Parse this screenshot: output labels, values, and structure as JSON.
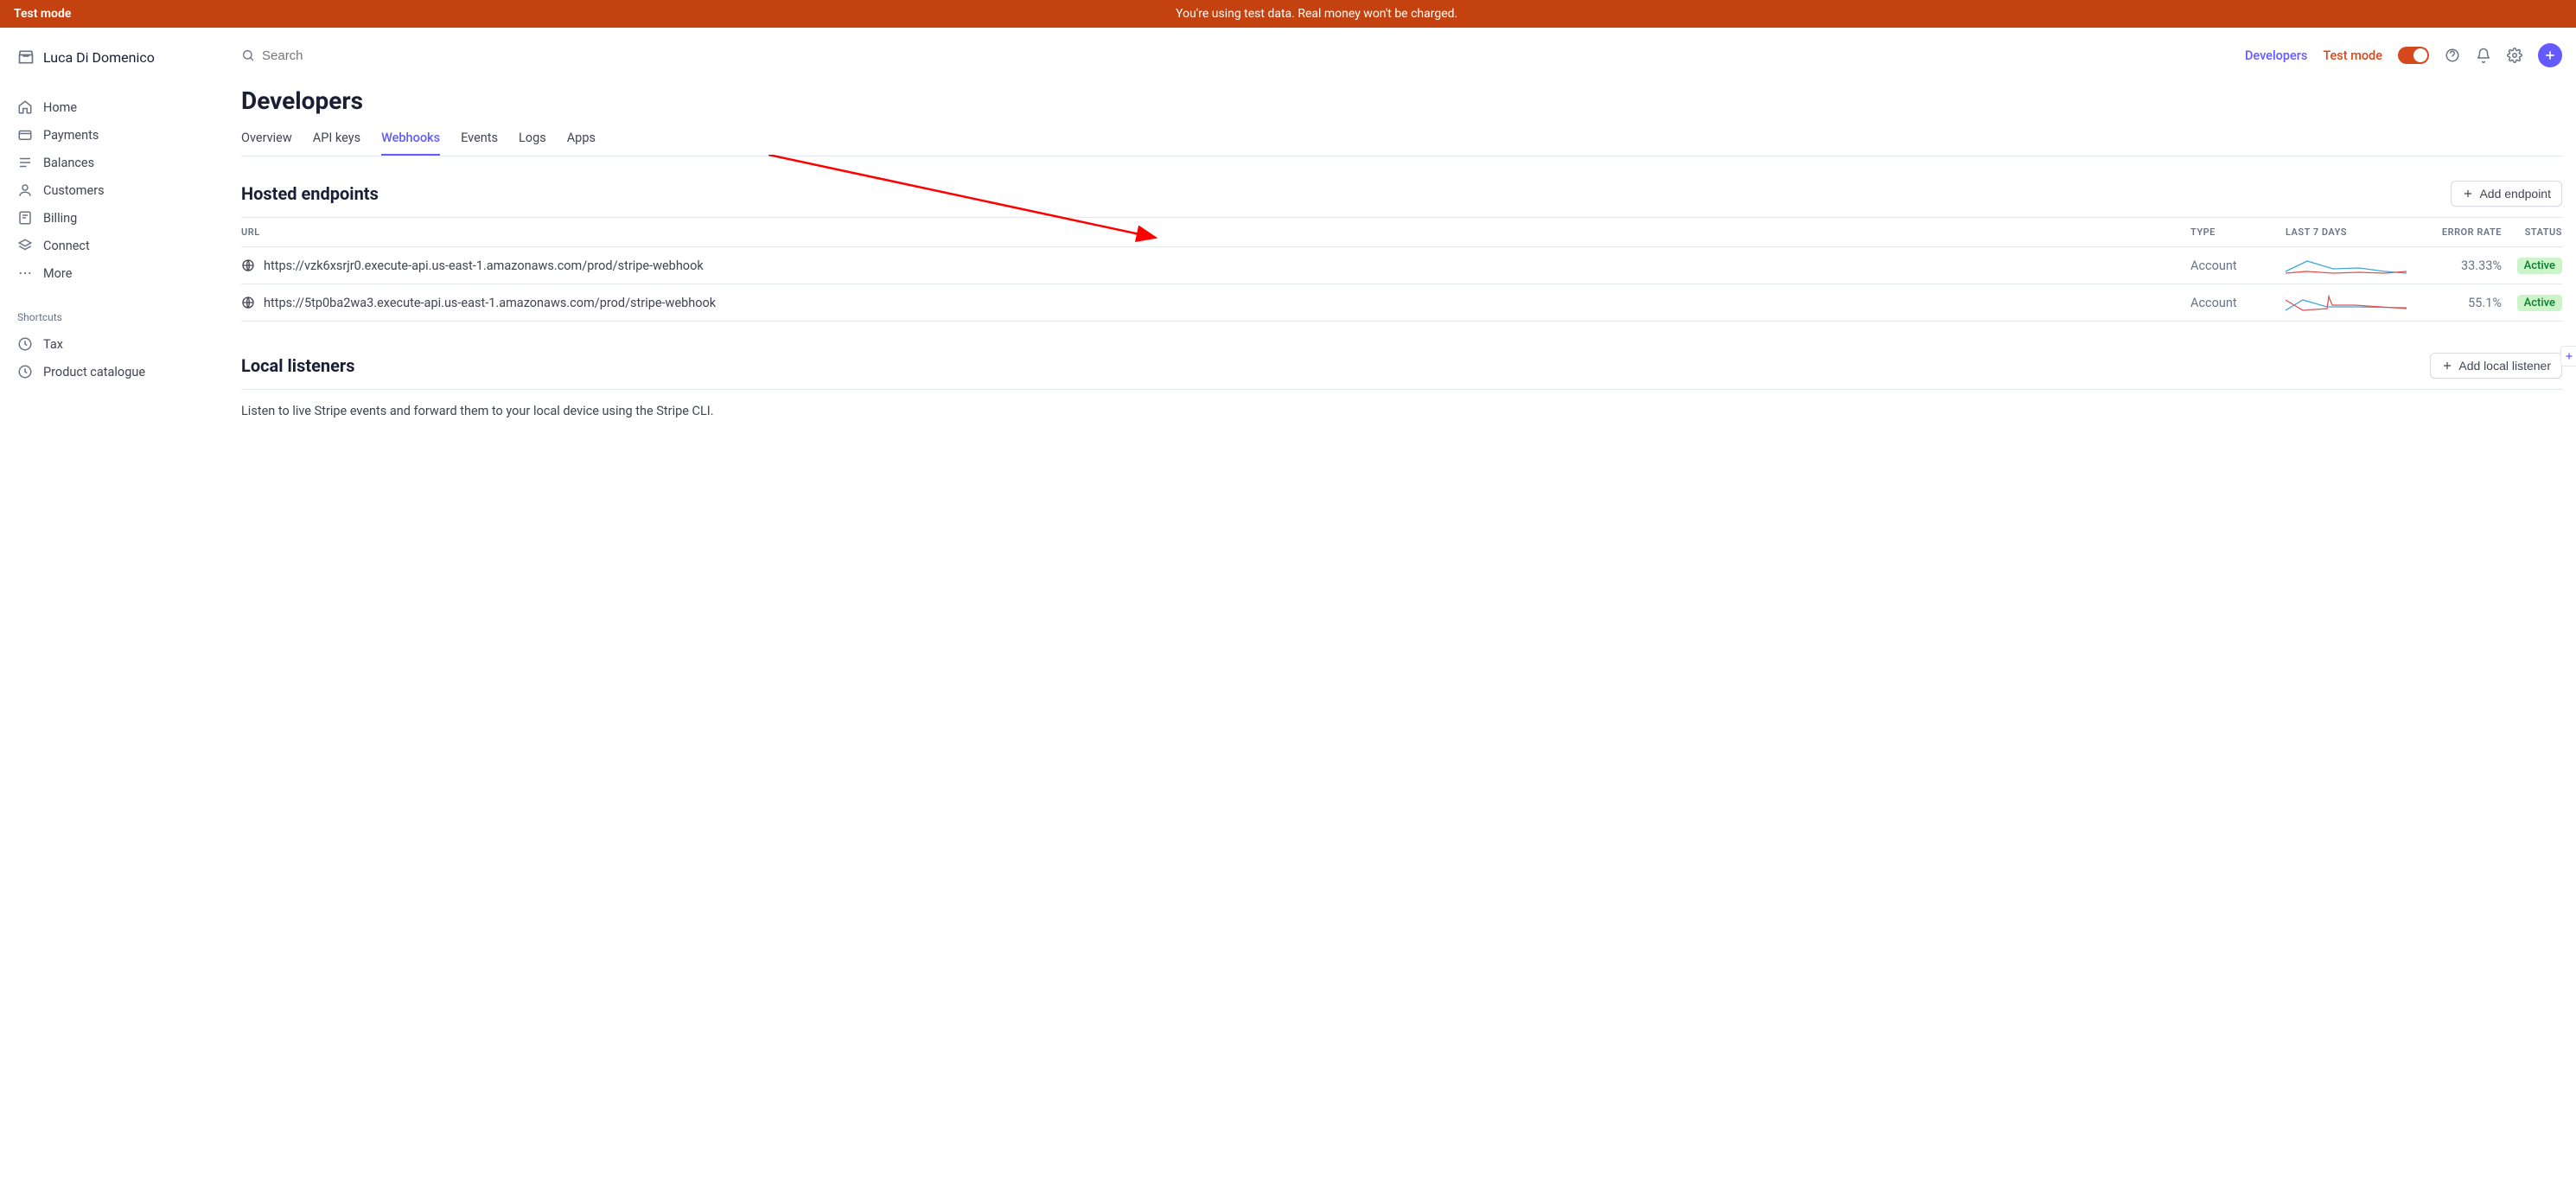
{
  "banner": {
    "left": "Test mode",
    "center": "You're using test data. Real money won't be charged."
  },
  "account": {
    "name": "Luca Di Domenico"
  },
  "nav": {
    "items": [
      {
        "label": "Home",
        "icon": "home"
      },
      {
        "label": "Payments",
        "icon": "payments"
      },
      {
        "label": "Balances",
        "icon": "balances"
      },
      {
        "label": "Customers",
        "icon": "customers"
      },
      {
        "label": "Billing",
        "icon": "billing"
      },
      {
        "label": "Connect",
        "icon": "connect"
      },
      {
        "label": "More",
        "icon": "more"
      }
    ],
    "shortcuts_label": "Shortcuts",
    "shortcuts": [
      {
        "label": "Tax",
        "icon": "clock"
      },
      {
        "label": "Product catalogue",
        "icon": "clock"
      }
    ]
  },
  "topbar": {
    "search_placeholder": "Search",
    "developers": "Developers",
    "testmode": "Test mode"
  },
  "page": {
    "title": "Developers"
  },
  "tabs": [
    "Overview",
    "API keys",
    "Webhooks",
    "Events",
    "Logs",
    "Apps"
  ],
  "active_tab": "Webhooks",
  "hosted": {
    "title": "Hosted endpoints",
    "add_button": "Add endpoint",
    "columns": {
      "url": "URL",
      "type": "TYPE",
      "days": "LAST 7 DAYS",
      "err": "ERROR RATE",
      "status": "STATUS"
    },
    "rows": [
      {
        "url": "https://vzk6xsrjr0.execute-api.us-east-1.amazonaws.com/prod/stripe-webhook",
        "type": "Account",
        "err": "33.33%",
        "status": "Active"
      },
      {
        "url": "https://5tp0ba2wa3.execute-api.us-east-1.amazonaws.com/prod/stripe-webhook",
        "type": "Account",
        "err": "55.1%",
        "status": "Active"
      }
    ]
  },
  "local": {
    "title": "Local listeners",
    "add_button": "Add local listener",
    "desc": "Listen to live Stripe events and forward them to your local device using the Stripe CLI."
  }
}
